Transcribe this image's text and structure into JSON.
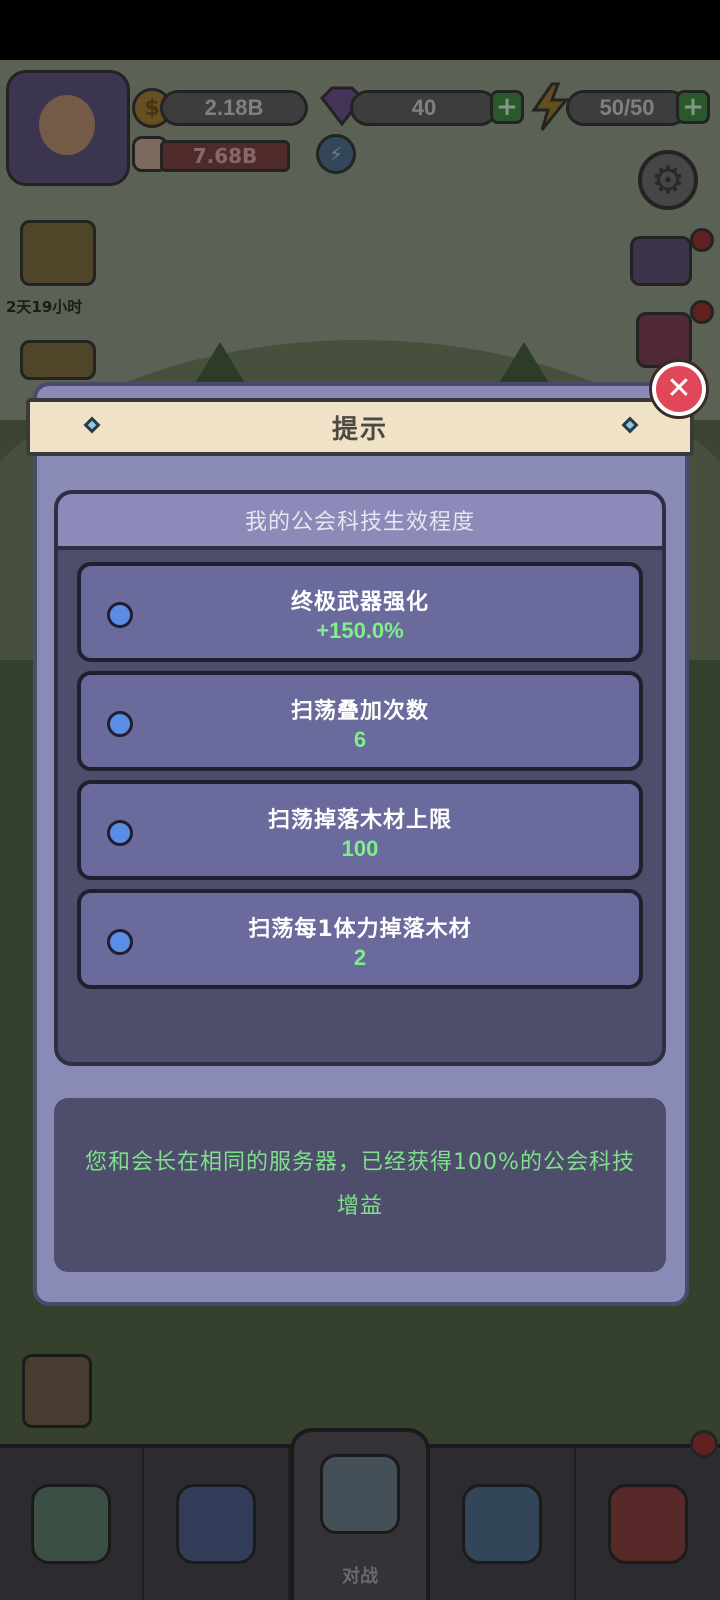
{
  "hud": {
    "coins": "2.18B",
    "gems": "40",
    "energy": "50/50",
    "power": "7.68B",
    "event_timer": "2天19小时",
    "battle_tab_label": "对战"
  },
  "dialog": {
    "title": "提示",
    "section_title": "我的公会科技生效程度",
    "techs": [
      {
        "name": "终极武器强化",
        "value": "+150.0%"
      },
      {
        "name": "扫荡叠加次数",
        "value": "6"
      },
      {
        "name": "扫荡掉落木材上限",
        "value": "100"
      },
      {
        "name": "扫荡每1体力掉落木材",
        "value": "2"
      }
    ],
    "info": "您和会长在相同的服务器，已经获得100%的公会科技增益"
  },
  "colors": {
    "dialog_bg": "#8a8ab6",
    "inner_panel": "#4e4e6c",
    "row_bg": "#6a6a9c",
    "value_green": "#7ef08a",
    "close_red": "#e0485a",
    "header_cream": "#efe2c6"
  }
}
